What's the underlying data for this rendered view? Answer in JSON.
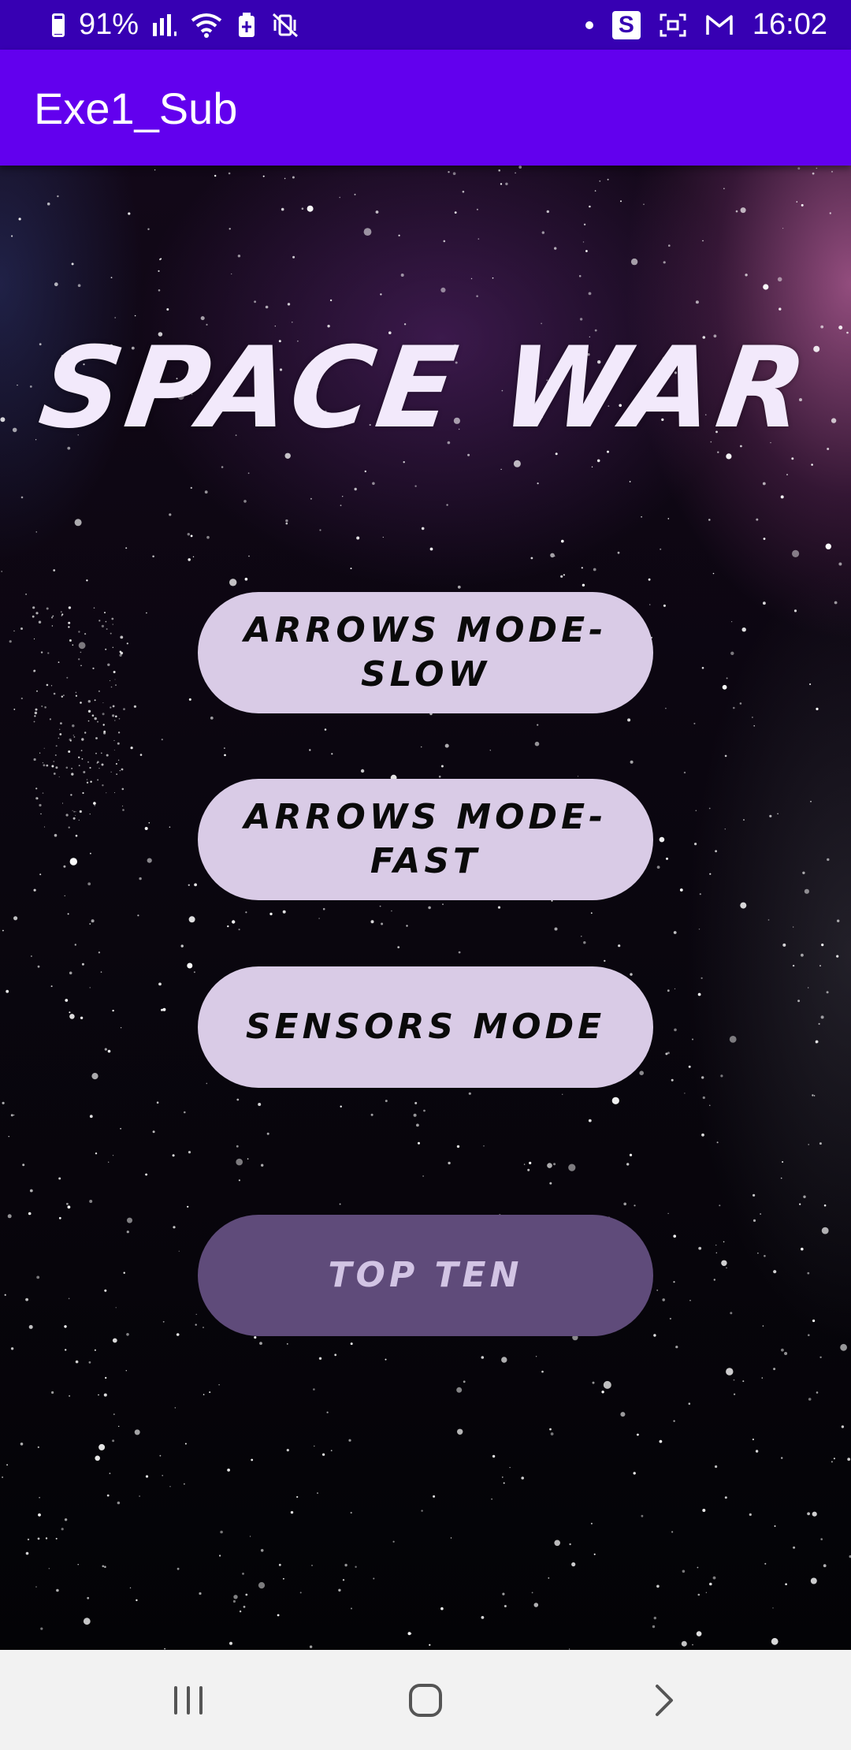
{
  "status_bar": {
    "battery_percent": "91%",
    "time": "16:02",
    "left_icons": [
      "battery-charging-icon",
      "signal-icon",
      "wifi-icon",
      "battery-saver-icon",
      "vibrate-mute-icon"
    ],
    "right_icons": [
      "notification-dot-icon",
      "s-app-icon",
      "screenshot-icon",
      "gmail-icon"
    ],
    "s_badge": "S"
  },
  "app_bar": {
    "title": "Exe1_Sub",
    "color": "#6200ee"
  },
  "screen": {
    "game_title": "SPACE WAR",
    "buttons": [
      {
        "label": "ARROWS MODE- SLOW",
        "enabled": true
      },
      {
        "label": "ARROWS MODE- FAST",
        "enabled": true
      },
      {
        "label": "SENSORS MODE",
        "enabled": true
      },
      {
        "label": "TOP TEN",
        "enabled": false
      }
    ]
  },
  "nav_bar": {
    "icons": [
      "recent-apps-icon",
      "home-icon",
      "back-icon"
    ]
  },
  "colors": {
    "status_bar": "#3700b3",
    "button_bg": "#d9cbe6",
    "button_disabled_bg": "#5f4b7a",
    "title_text": "#f2e9fb"
  }
}
